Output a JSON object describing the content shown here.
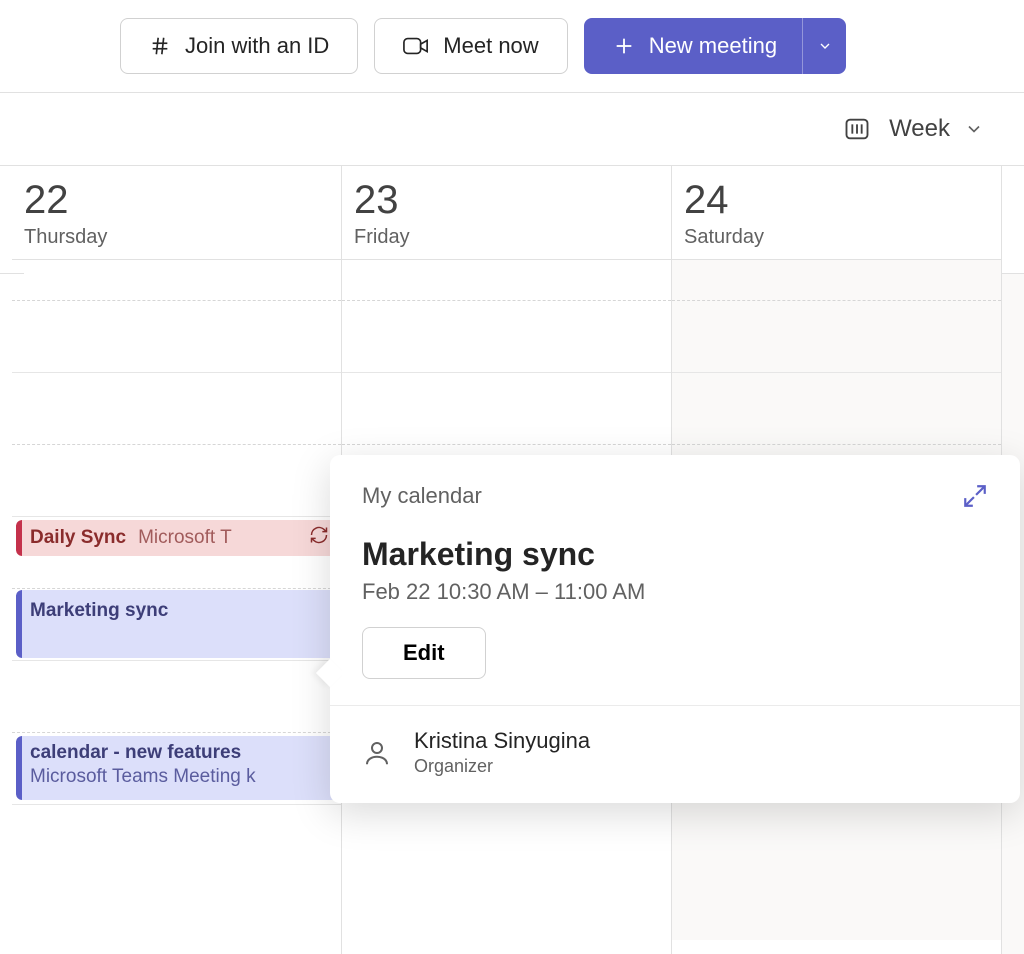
{
  "toolbar": {
    "join_id_label": "Join with an ID",
    "meet_now_label": "Meet now",
    "new_meeting_label": "New meeting"
  },
  "view": {
    "label": "Week"
  },
  "days": [
    {
      "num": "22",
      "name": "Thursday"
    },
    {
      "num": "23",
      "name": "Friday"
    },
    {
      "num": "24",
      "name": "Saturday"
    }
  ],
  "events": {
    "daily_sync": {
      "title": "Daily Sync",
      "sub": "Microsoft T"
    },
    "marketing_sync": {
      "title": "Marketing sync"
    },
    "new_features": {
      "title": "calendar - new features",
      "sub": "Microsoft Teams Meeting   k"
    }
  },
  "popover": {
    "calendar_name": "My calendar",
    "title": "Marketing sync",
    "time": "Feb 22 10:30 AM – 11:00 AM",
    "edit_label": "Edit",
    "organizer_name": "Kristina Sinyugina",
    "organizer_role": "Organizer"
  }
}
